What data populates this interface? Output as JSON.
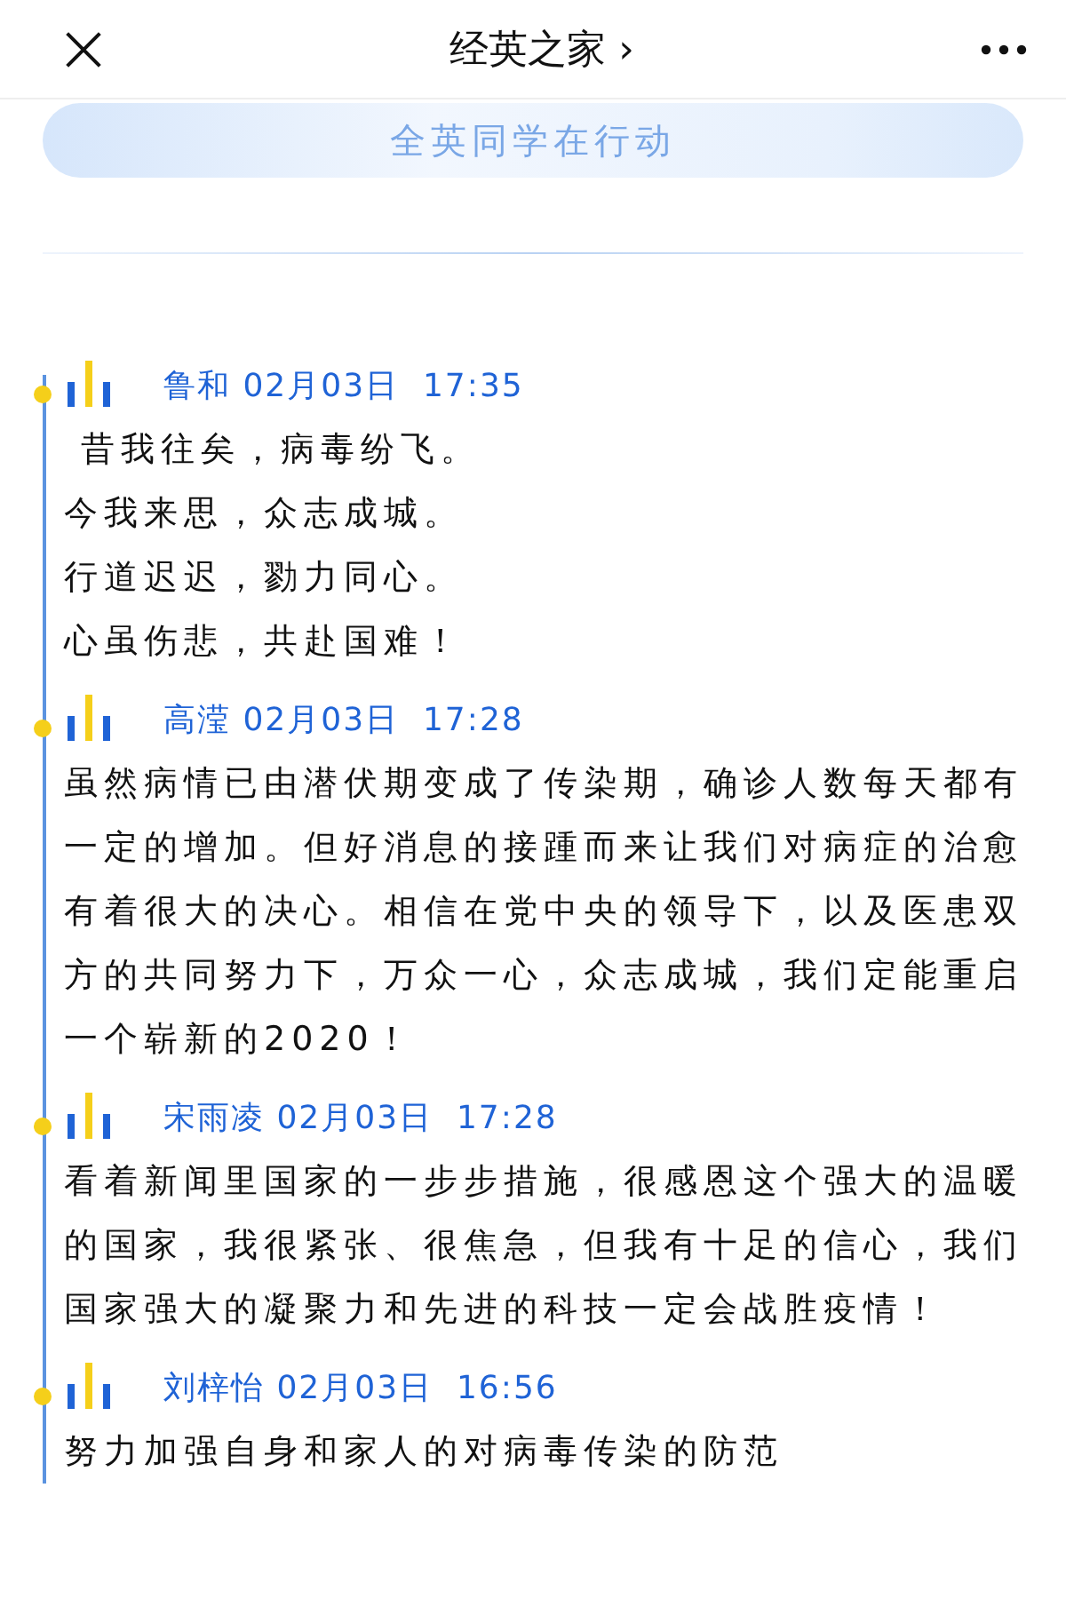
{
  "nav": {
    "title": "经英之家",
    "chevron": "›"
  },
  "banner": {
    "text": "全英同学在行动"
  },
  "posts": [
    {
      "author": "鲁和",
      "date": "02月03日",
      "time": "17:35",
      "lines": [
        " 昔我往矣，病毒纷飞。",
        "今我来思，众志成城。",
        "行道迟迟，勠力同心。",
        "心虽伤悲，共赴国难！"
      ]
    },
    {
      "author": "高滢",
      "date": "02月03日",
      "time": "17:28",
      "lines": [
        "虽然病情已由潜伏期变成了传染期，确诊人数每天都有一定的增加。但好消息的接踵而来让我们对病症的治愈有着很大的决心。相信在党中央的领导下，以及医患双方的共同努力下，万众一心，众志成城，我们定能重启一个崭新的2020！"
      ]
    },
    {
      "author": "宋雨凌",
      "date": "02月03日",
      "time": "17:28",
      "lines": [
        "看着新闻里国家的一步步措施，很感恩这个强大的温暖的国家，我很紧张、很焦急，但我有十足的信心，我们国家强大的凝聚力和先进的科技一定会战胜疫情！"
      ]
    },
    {
      "author": "刘梓怡",
      "date": "02月03日",
      "time": "16:56",
      "lines": [
        "努力加强自身和家人的对病毒传染的防范"
      ]
    }
  ]
}
